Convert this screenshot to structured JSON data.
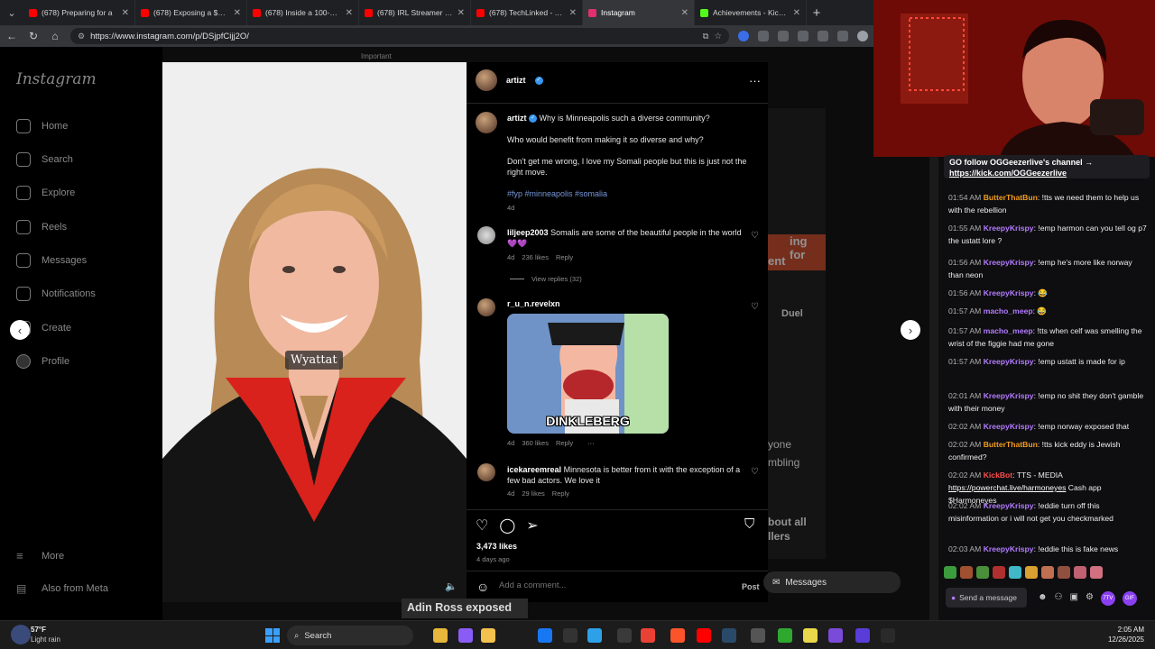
{
  "browser": {
    "tabs": [
      {
        "title": "(678) Preparing for a",
        "color": "#ff0000"
      },
      {
        "title": "(678) Exposing a $10,00",
        "color": "#ff0000"
      },
      {
        "title": "(678) Inside a 100-Year",
        "color": "#ff0000"
      },
      {
        "title": "(678) IRL Streamer Clavi",
        "color": "#ff0000"
      },
      {
        "title": "(678) TechLinked - YouT",
        "color": "#ff0000"
      },
      {
        "title": "Instagram",
        "color": "#e1306c",
        "active": true
      },
      {
        "title": "Achievements - Kick Da",
        "color": "#53fc18"
      }
    ],
    "url": "https://www.instagram.com/p/DSjpfCijj2O/"
  },
  "instagram": {
    "logo": "Instagram",
    "important": "Important",
    "nav": [
      "Home",
      "Search",
      "Explore",
      "Reels",
      "Messages",
      "Notifications",
      "Create",
      "Profile"
    ],
    "more": "More",
    "also": "Also from Meta",
    "photo_label": "Wyattat",
    "post": {
      "author": "artizt",
      "caption_q": "Why is Minneapolis such a diverse community?",
      "caption_2": "Who would benefit from making it so diverse and why?",
      "caption_3": "Don't get me wrong, I love my Somali people but this is just not the right move.",
      "hashtags": "#fyp #minneapolis #somalia",
      "age": "4d",
      "likes": "3,473 likes",
      "posted": "4 days ago",
      "add_comment": "Add a comment...",
      "post_btn": "Post"
    },
    "comments": [
      {
        "user": "liljeep2003",
        "text": "Somalis are some of the beautiful people in the world 💜💜",
        "age": "4d",
        "likes": "236 likes",
        "reply": "Reply",
        "view_replies": "View replies (32)"
      },
      {
        "user": "r_u_n.revelxn",
        "text": "",
        "age": "4d",
        "likes": "360 likes",
        "reply": "Reply",
        "meme": "DINKLEBERG"
      },
      {
        "user": "icekareemreal",
        "text": "Minnesota is better from it with the exception of a few bad actors. We love it",
        "age": "4d",
        "likes": "29 likes",
        "reply": "Reply"
      }
    ],
    "bg_texts": [
      "Duel",
      "ing for",
      "ent",
      "yone",
      "mbling",
      "bout all",
      "llers"
    ],
    "messages_btn": "Messages",
    "bottom_overlay": "Adin Ross exposed"
  },
  "chat": {
    "pinned": "GO follow OGGeezerlive's channel →",
    "pinned_link": "https://kick.com/OGGeezerlive",
    "messages": [
      {
        "time": "01:54 AM",
        "user": "ButterThatBun",
        "color": "orange",
        "text": "!tts we need them to help us with the rebellion"
      },
      {
        "time": "01:55 AM",
        "user": "KreepyKrispy",
        "color": "purple",
        "text": "!emp      harmon can you tell og p7 the ustatt lore ?"
      },
      {
        "time": "01:56 AM",
        "user": "KreepyKrispy",
        "color": "purple",
        "text": "!emp he's more like norway than neon"
      },
      {
        "time": "01:56 AM",
        "user": "KreepyKrispy",
        "color": "purple",
        "text": "😂"
      },
      {
        "time": "01:57 AM",
        "user": "macho_meep",
        "color": "purple",
        "text": "😂"
      },
      {
        "time": "01:57 AM",
        "user": "macho_meep",
        "color": "purple",
        "text": "!tts when celf was smelling the wrist of the figgie had me gone"
      },
      {
        "time": "01:57 AM",
        "user": "KreepyKrispy",
        "color": "purple",
        "text": "!emp ustatt is made for ip"
      },
      {
        "time": "02:01 AM",
        "user": "KreepyKrispy",
        "color": "purple",
        "text": "!emp no shit they don't gamble with their money"
      },
      {
        "time": "02:02 AM",
        "user": "KreepyKrispy",
        "color": "purple",
        "text": "!emp norway exposed that"
      },
      {
        "time": "02:02 AM",
        "user": "ButterThatBun",
        "color": "orange",
        "text": "!tts kick eddy is Jewish confirmed?"
      },
      {
        "time": "02:02 AM",
        "user": "KickBot",
        "color": "red",
        "text": "TTS - MEDIA",
        "link": "https://powerchat.live/harmoneyes",
        "after": "Cash app $Harmoneyes"
      },
      {
        "time": "02:02 AM",
        "user": "KreepyKrispy",
        "color": "purple",
        "text": "!eddie turn off this misinformation or i will not get you checkmarked"
      },
      {
        "time": "02:03 AM",
        "user": "KreepyKrispy",
        "color": "purple",
        "text": "!eddie this is fake news"
      }
    ],
    "send_placeholder": "Send a message"
  },
  "taskbar": {
    "weather_temp": "57°F",
    "weather_desc": "Light rain",
    "search": "Search",
    "time": "2:05 AM",
    "date": "12/26/2025"
  }
}
